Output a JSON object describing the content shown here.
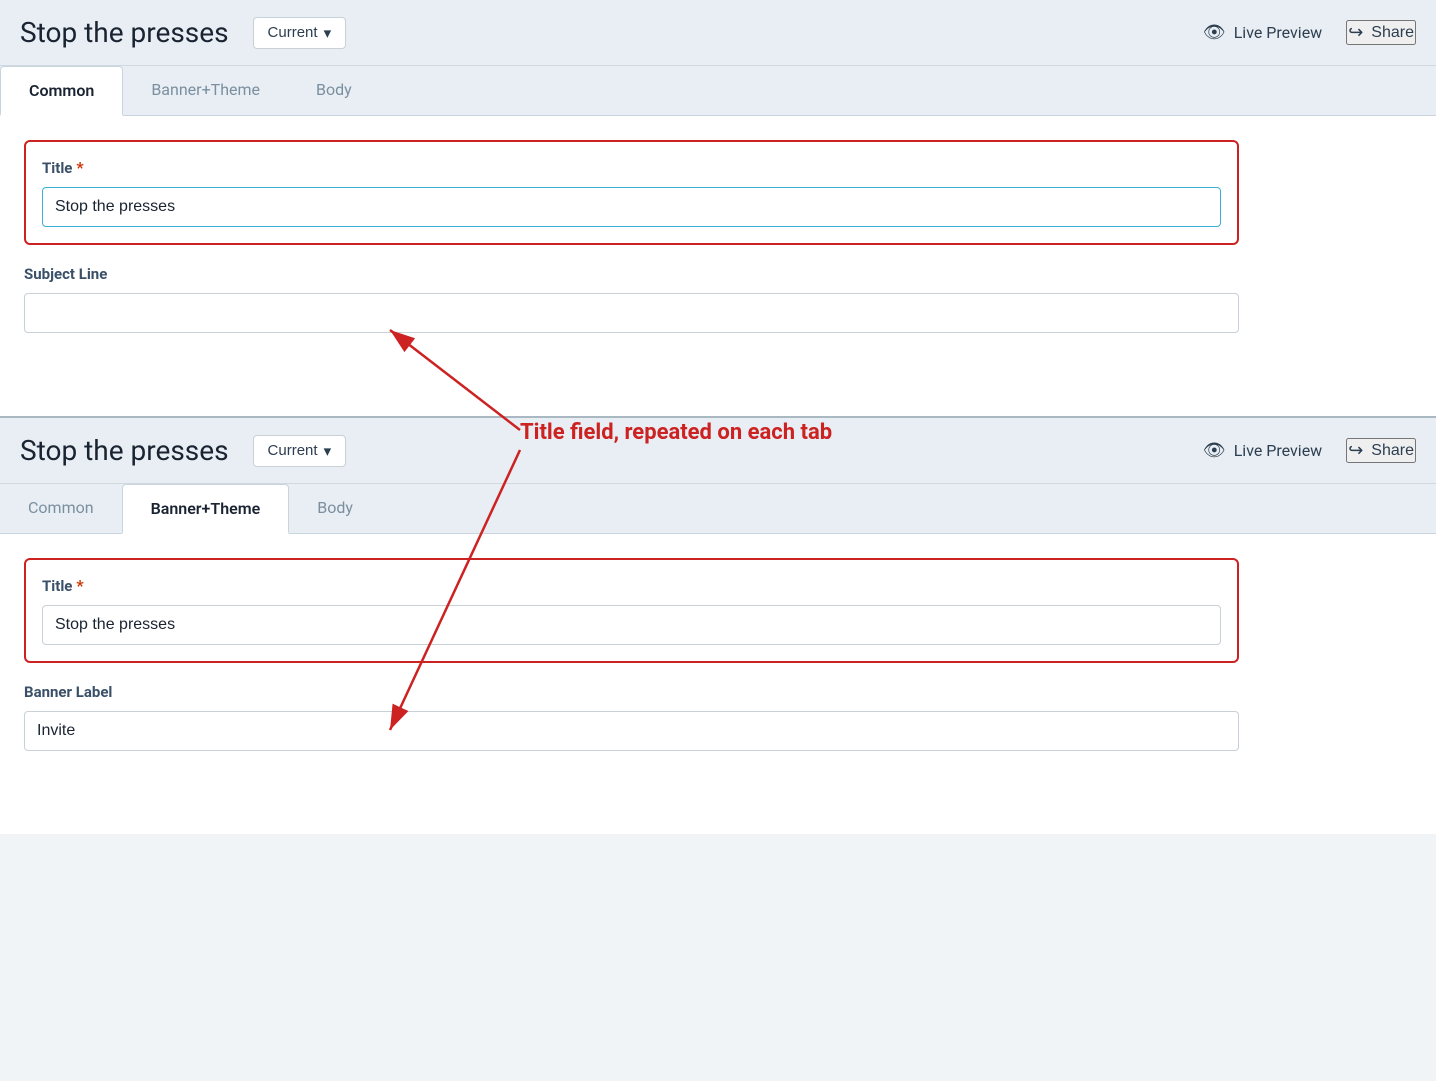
{
  "panel1": {
    "title": "Stop the presses",
    "version_label": "Current",
    "version_arrow": "▾",
    "live_preview_label": "Live Preview",
    "share_label": "Share",
    "tabs": [
      {
        "id": "common",
        "label": "Common",
        "active": true
      },
      {
        "id": "banner_theme",
        "label": "Banner+Theme",
        "active": false
      },
      {
        "id": "body",
        "label": "Body",
        "active": false
      }
    ],
    "title_field": {
      "label": "Title",
      "required": true,
      "value": "Stop the presses",
      "placeholder": ""
    },
    "subject_line_field": {
      "label": "Subject Line",
      "required": false,
      "value": "",
      "placeholder": ""
    }
  },
  "annotation": {
    "text": "Title field, repeated on each tab"
  },
  "panel2": {
    "title": "Stop the presses",
    "version_label": "Current",
    "version_arrow": "▾",
    "live_preview_label": "Live Preview",
    "share_label": "Share",
    "tabs": [
      {
        "id": "common",
        "label": "Common",
        "active": false
      },
      {
        "id": "banner_theme",
        "label": "Banner+Theme",
        "active": true
      },
      {
        "id": "body",
        "label": "Body",
        "active": false
      }
    ],
    "title_field": {
      "label": "Title",
      "required": true,
      "value": "Stop the presses",
      "placeholder": ""
    },
    "banner_label_field": {
      "label": "Banner Label",
      "required": false,
      "value": "Invite",
      "placeholder": ""
    }
  },
  "icons": {
    "eye": "👁",
    "share": "↪",
    "chevron_down": "∨"
  }
}
